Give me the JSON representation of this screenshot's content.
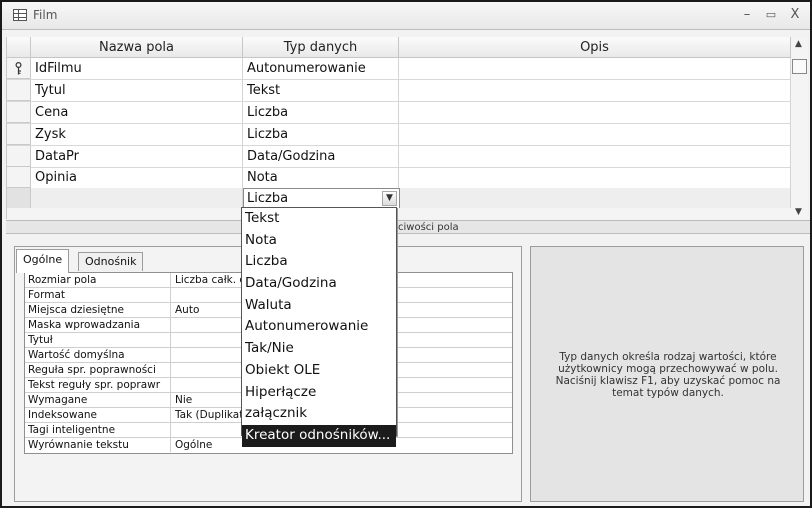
{
  "window": {
    "title": "Film",
    "minimize": "–",
    "restore": "▭",
    "close": "X"
  },
  "grid": {
    "headers": {
      "name": "Nazwa pola",
      "type": "Typ danych",
      "desc": "Opis"
    },
    "rows": [
      {
        "name": "IdFilmu",
        "type": "Autonumerowanie",
        "desc": "",
        "primary_key": true
      },
      {
        "name": "Tytul",
        "type": "Tekst",
        "desc": ""
      },
      {
        "name": "Cena",
        "type": "Liczba",
        "desc": ""
      },
      {
        "name": "Zysk",
        "type": "Liczba",
        "desc": ""
      },
      {
        "name": "DataPr",
        "type": "Data/Godzina",
        "desc": ""
      },
      {
        "name": "Opinia",
        "type": "Nota",
        "desc": ""
      }
    ],
    "current_row_type_value": "Liczba"
  },
  "properties": {
    "caption": "ciwości pola",
    "tabs": {
      "general": "Ogólne",
      "lookup": "Odnośnik"
    },
    "rows": [
      {
        "label": "Rozmiar pola",
        "value": "Liczba całk. d"
      },
      {
        "label": "Format",
        "value": ""
      },
      {
        "label": "Miejsca dziesiętne",
        "value": "Auto"
      },
      {
        "label": "Maska wprowadzania",
        "value": ""
      },
      {
        "label": "Tytuł",
        "value": ""
      },
      {
        "label": "Wartość domyślna",
        "value": ""
      },
      {
        "label": "Reguła spr. poprawności",
        "value": ""
      },
      {
        "label": "Tekst reguły spr. poprawr",
        "value": ""
      },
      {
        "label": "Wymagane",
        "value": "Nie"
      },
      {
        "label": "Indeksowane",
        "value": "Tak (Duplikat"
      },
      {
        "label": "Tagi inteligentne",
        "value": ""
      },
      {
        "label": "Wyrównanie tekstu",
        "value": "Ogólne"
      }
    ]
  },
  "help": {
    "text": "Typ danych określa rodzaj wartości, które użytkownicy mogą przechowywać w polu. Naciśnij klawisz F1, aby uzyskać pomoc na temat typów danych."
  },
  "dropdown": {
    "options": [
      "Tekst",
      "Nota",
      "Liczba",
      "Data/Godzina",
      "Waluta",
      "Autonumerowanie",
      "Tak/Nie",
      "Obiekt OLE",
      "Hiperłącze",
      "załącznik",
      "Kreator odnośników..."
    ],
    "highlighted": "Kreator odnośników..."
  }
}
